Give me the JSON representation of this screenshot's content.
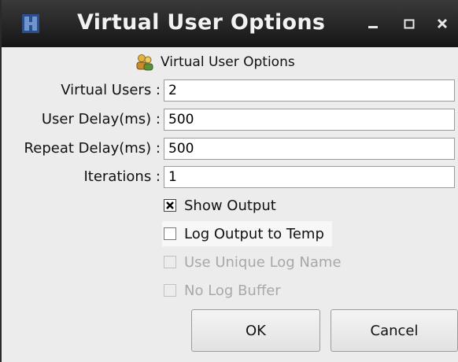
{
  "window": {
    "title": "Virtual User Options",
    "buttons": {
      "minimize": "minimize-icon",
      "maximize": "maximize-icon",
      "close": "close-icon"
    }
  },
  "header": {
    "icon": "users-icon",
    "label": "Virtual User Options"
  },
  "fields": [
    {
      "label": "Virtual Users :",
      "value": "2"
    },
    {
      "label": "User Delay(ms) :",
      "value": "500"
    },
    {
      "label": "Repeat Delay(ms) :",
      "value": "500"
    },
    {
      "label": "Iterations :",
      "value": "1"
    }
  ],
  "checkboxes": [
    {
      "label": "Show Output",
      "checked": true,
      "enabled": true
    },
    {
      "label": "Log Output to Temp",
      "checked": false,
      "enabled": true
    },
    {
      "label": "Use Unique Log Name",
      "checked": false,
      "enabled": false
    },
    {
      "label": "No Log Buffer",
      "checked": false,
      "enabled": false
    }
  ],
  "actions": {
    "ok_label": "OK",
    "cancel_label": "Cancel"
  },
  "colors": {
    "titlebar": "#1e1e1e",
    "dialog_bg": "#ececec",
    "disabled_text": "#a8a8a8"
  }
}
